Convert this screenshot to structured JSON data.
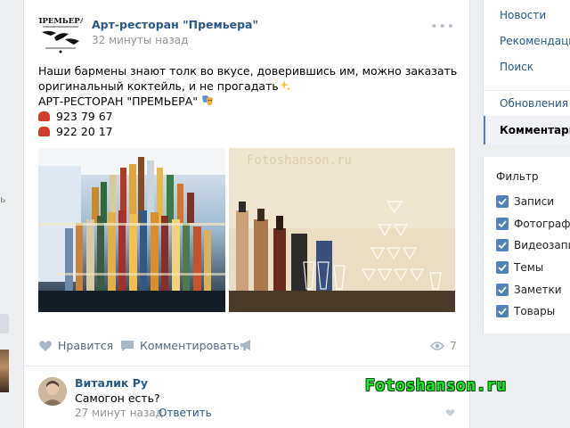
{
  "post": {
    "page_name": "Арт-ресторан \"Премьера\"",
    "time": "32 минуты назад",
    "more_label": "•••",
    "logo_text": "ПРЕМЬЕРА",
    "text_line1": "Наши бармены знают толк во вкусе, доверившись им, можно заказать",
    "text_line2": "оригинальный коктейль, и не прогадать",
    "text_line3": "АРТ-РЕСТОРАН \"ПРЕМЬЕРА\"",
    "phone1": "923 79 67",
    "phone2": "922 20 17",
    "photo2_watermark": "Fotoshanson.ru"
  },
  "actions": {
    "like_label": "Нравится",
    "comment_label": "Комментировать",
    "views_count": "7"
  },
  "comment": {
    "author": "Виталик Ру",
    "text": "Самогон есть?",
    "time": "27 минут назад",
    "reply_label": "Ответить"
  },
  "watermark": "Fotoshanson.ru",
  "left_fragments": {
    "dot": "ь"
  },
  "menu": {
    "items": [
      "Новости",
      "Рекомендации",
      "Поиск",
      "Обновления",
      "Комментарии"
    ]
  },
  "filter": {
    "title": "Фильтр",
    "items": [
      "Записи",
      "Фотографии",
      "Видеозаписи",
      "Темы",
      "Заметки",
      "Товары"
    ]
  },
  "colors": {
    "link": "#2a5885",
    "accent": "#5181b8",
    "background": "#edeef0",
    "watermark": "#22e22a"
  }
}
